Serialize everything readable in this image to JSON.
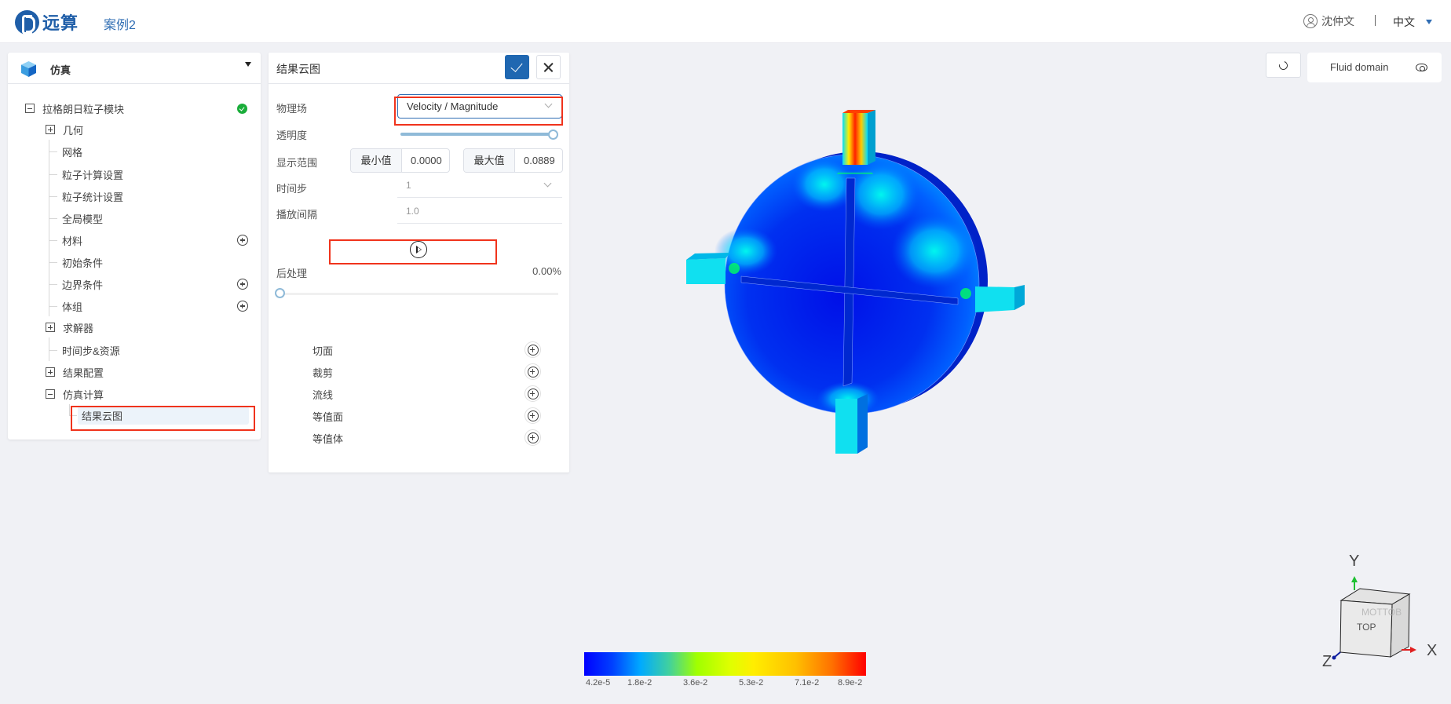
{
  "header": {
    "logo_text": "远算",
    "case_name": "案例2",
    "user_name": "沈仲文",
    "language": "中文"
  },
  "left_panel": {
    "title": "仿真",
    "tree": [
      {
        "label": "拉格朗日粒子模块",
        "level": 0,
        "expander": "minus",
        "status": "success"
      },
      {
        "label": "几何",
        "level": 1,
        "expander": "plus"
      },
      {
        "label": "网格",
        "level": 1
      },
      {
        "label": "粒子计算设置",
        "level": 1
      },
      {
        "label": "粒子统计设置",
        "level": 1
      },
      {
        "label": "全局模型",
        "level": 1
      },
      {
        "label": "材料",
        "level": 1,
        "action": "add"
      },
      {
        "label": "初始条件",
        "level": 1
      },
      {
        "label": "边界条件",
        "level": 1,
        "action": "add"
      },
      {
        "label": "体组",
        "level": 1,
        "action": "add"
      },
      {
        "label": "求解器",
        "level": 1,
        "expander": "plus"
      },
      {
        "label": "时间步&资源",
        "level": 1
      },
      {
        "label": "结果配置",
        "level": 1,
        "expander": "plus"
      },
      {
        "label": "仿真计算",
        "level": 1,
        "expander": "minus"
      },
      {
        "label": "结果云图",
        "level": 2,
        "selected": true
      }
    ]
  },
  "form_panel": {
    "title": "结果云图",
    "fields": {
      "physics_label": "物理场",
      "physics_value": "Velocity / Magnitude",
      "opacity_label": "透明度",
      "opacity_value": 1.0,
      "range_label": "显示范围",
      "min_label": "最小值",
      "min_value": "0.0000",
      "max_label": "最大值",
      "max_value": "0.0889",
      "timestep_label": "时间步",
      "timestep_value": "1",
      "interval_label": "播放间隔",
      "interval_value": "1.0"
    },
    "playback": {
      "progress_text": "0.00%",
      "progress": 0.0
    },
    "postprocess": {
      "title": "后处理",
      "items": [
        "切面",
        "裁剪",
        "流线",
        "等值面",
        "等值体"
      ]
    }
  },
  "viewport": {
    "domain_label": "Fluid domain",
    "colorbar": {
      "field": "Velocity / Magnitude",
      "labels": [
        "4.2e-5",
        "1.8e-2",
        "3.6e-2",
        "5.3e-2",
        "7.1e-2",
        "8.9e-2"
      ],
      "colors": [
        "#0000ff",
        "#00aaff",
        "#a0ff00",
        "#ffee00",
        "#ffc000",
        "#ff0000"
      ]
    },
    "axes": {
      "x": "X",
      "y": "Y",
      "z": "Z",
      "cube_face_front": "TOP",
      "cube_face_back": "BOTTOM"
    }
  },
  "colors": {
    "accent": "#1f67b1",
    "highlight": "#f0331c",
    "success": "#1aad3a"
  }
}
